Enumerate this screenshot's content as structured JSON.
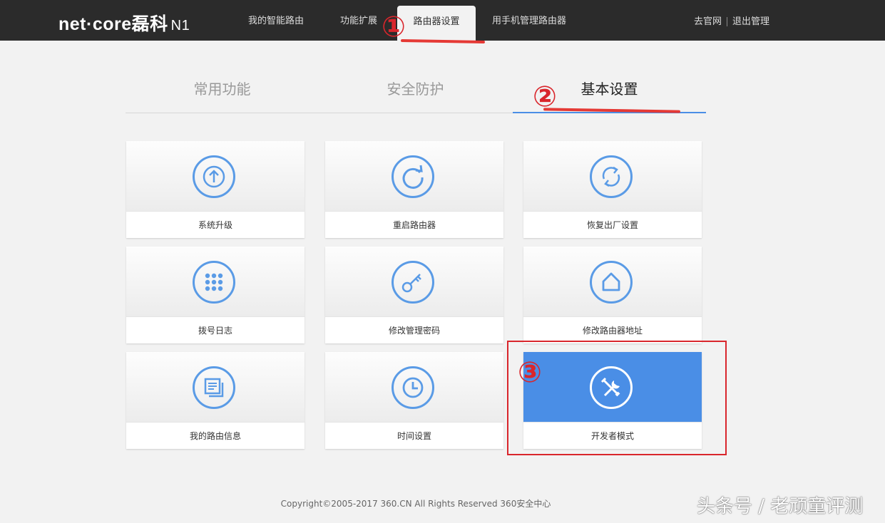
{
  "header": {
    "logo_text": "net·core",
    "logo_cn": "磊科",
    "logo_model": "N1",
    "nav": [
      {
        "label": "我的智能路由",
        "active": false
      },
      {
        "label": "功能扩展",
        "active": false
      },
      {
        "label": "路由器设置",
        "active": true
      },
      {
        "label": "用手机管理路由器",
        "active": false
      }
    ],
    "links": {
      "official_site": "去官网",
      "logout": "退出管理"
    }
  },
  "tabs": [
    {
      "label": "常用功能",
      "active": false
    },
    {
      "label": "安全防护",
      "active": false
    },
    {
      "label": "基本设置",
      "active": true
    }
  ],
  "cards": [
    {
      "label": "系统升级",
      "icon": "upgrade-icon"
    },
    {
      "label": "重启路由器",
      "icon": "restart-icon"
    },
    {
      "label": "恢复出厂设置",
      "icon": "factory-reset-icon"
    },
    {
      "label": "拨号日志",
      "icon": "dialpad-icon"
    },
    {
      "label": "修改管理密码",
      "icon": "key-icon"
    },
    {
      "label": "修改路由器地址",
      "icon": "home-icon"
    },
    {
      "label": "我的路由信息",
      "icon": "info-doc-icon"
    },
    {
      "label": "时间设置",
      "icon": "clock-icon"
    },
    {
      "label": "开发者模式",
      "icon": "tools-icon",
      "highlighted": true
    }
  ],
  "annotations": [
    "①",
    "②",
    "③"
  ],
  "footer": "Copyright©2005-2017 360.CN All Rights Reserved 360安全中心",
  "watermark": "头条号 / 老顽童评测",
  "colors": {
    "accent": "#4a8ee6",
    "topbar": "#2b2b2b",
    "annotation_red": "#d9262c"
  }
}
